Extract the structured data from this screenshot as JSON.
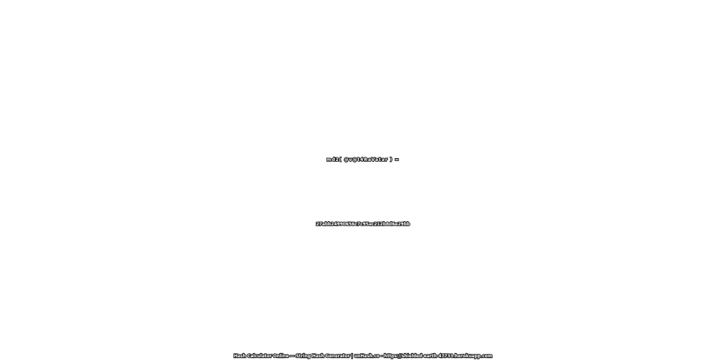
{
  "expression": "md2( @v@t4RaVatar ) =",
  "hash": "27abb24990656c7c95ac212b8d6e29bb",
  "footer": "Hash Calculator Online — String Hash Generator | unHash.co - https://shielded-earth-47733.herokuapp.com"
}
